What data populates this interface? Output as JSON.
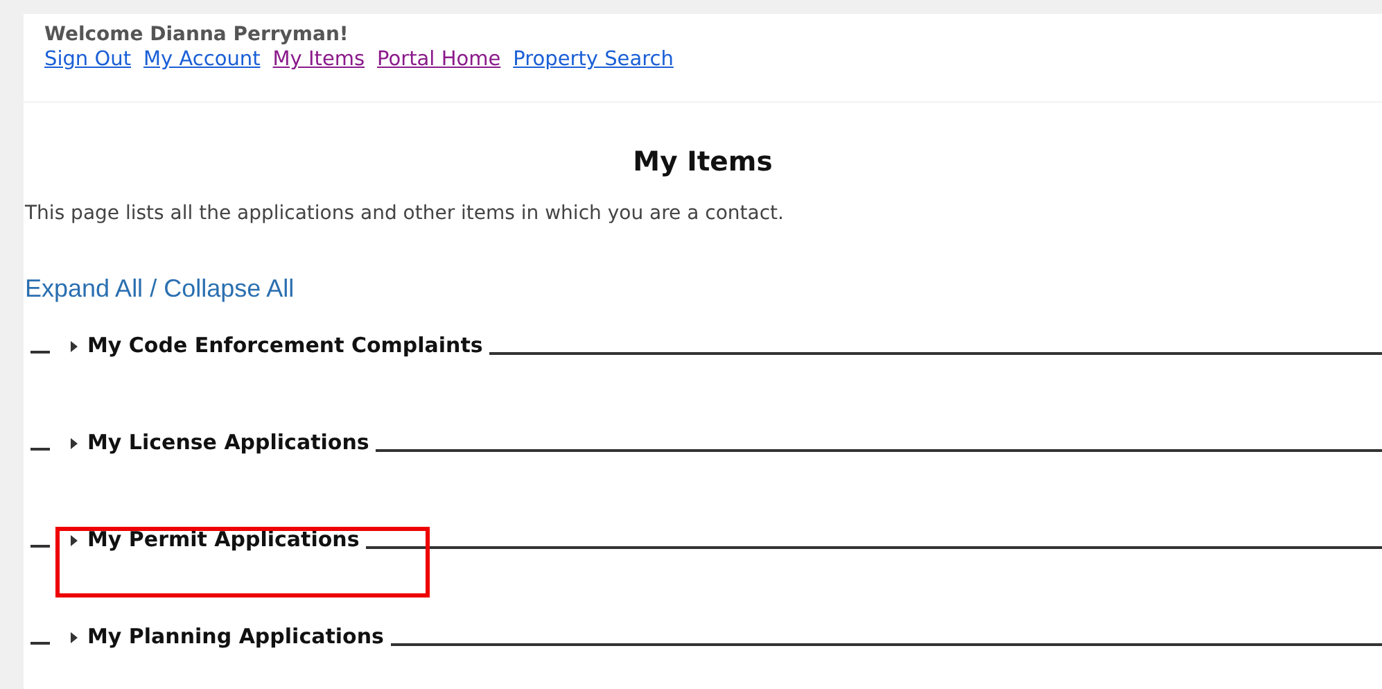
{
  "header": {
    "welcome": "Welcome Dianna Perryman!",
    "links": [
      {
        "label": "Sign Out",
        "visited": false
      },
      {
        "label": "My Account",
        "visited": false
      },
      {
        "label": "My Items",
        "visited": true
      },
      {
        "label": "Portal Home",
        "visited": true
      },
      {
        "label": "Property Search",
        "visited": false
      }
    ]
  },
  "title": "My Items",
  "description": "This page lists all the applications and other items in which you are a contact.",
  "expand_all": "Expand All",
  "separator": "/",
  "collapse_all": "Collapse All",
  "sections": [
    {
      "title": "My Code Enforcement Complaints",
      "expanded": false,
      "highlighted": false
    },
    {
      "title": "My License Applications",
      "expanded": false,
      "highlighted": false
    },
    {
      "title": "My Permit Applications",
      "expanded": false,
      "highlighted": true
    },
    {
      "title": "My Planning Applications",
      "expanded": false,
      "highlighted": false
    }
  ]
}
